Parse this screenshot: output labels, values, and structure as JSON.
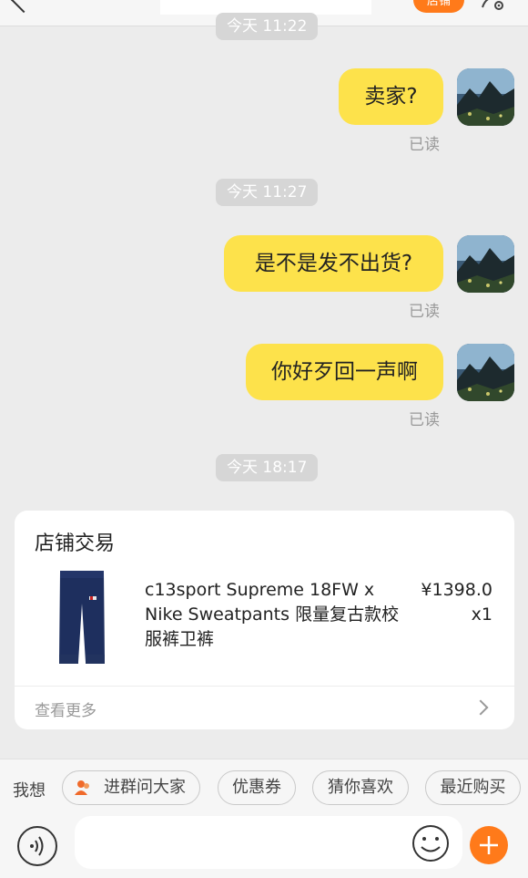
{
  "header": {
    "badge_label": "店铺"
  },
  "chat": {
    "timestamps": [
      "今天 11:22",
      "今天 11:27",
      "今天 18:17"
    ],
    "messages": [
      {
        "text": "卖家?",
        "status": "已读"
      },
      {
        "text": "是不是发不出货?",
        "status": "已读"
      },
      {
        "text": "你好歹回一声啊",
        "status": "已读"
      }
    ]
  },
  "order_card": {
    "title": "店铺交易",
    "product_name": "c13sport Supreme 18FW x Nike Sweatpants 限量复古款校服裤卫裤",
    "price": "¥1398.0",
    "quantity": "x1",
    "more_label": "查看更多"
  },
  "bottom_bar": {
    "prefix": "我想",
    "chips": [
      "进群问大家",
      "优惠券",
      "猜你喜欢",
      "最近购买"
    ],
    "input_value": ""
  },
  "colors": {
    "accent_orange": "#ff7a1a",
    "bubble_yellow": "#fde24b",
    "background": "#ececec"
  }
}
